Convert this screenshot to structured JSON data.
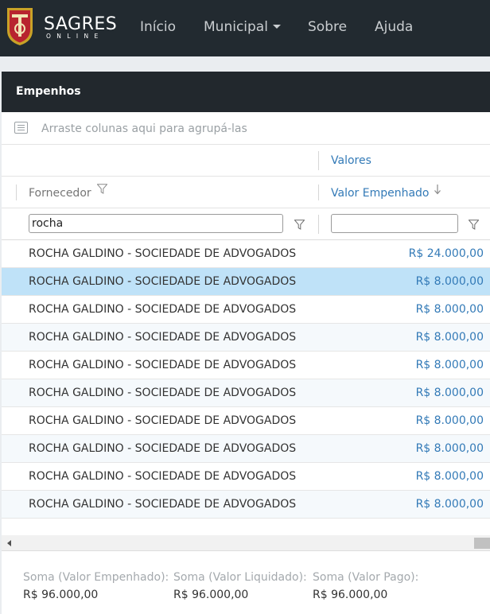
{
  "navbar": {
    "brand": "SAGRES",
    "brand_sub": "ONLINE",
    "items": [
      {
        "label": "Início"
      },
      {
        "label": "Municipal",
        "dropdown": true
      },
      {
        "label": "Sobre"
      },
      {
        "label": "Ajuda"
      }
    ],
    "colors": {
      "background": "#222a30",
      "text": "#c9cdd0"
    }
  },
  "panel": {
    "title": "Empenhos"
  },
  "grid": {
    "group_placeholder": "Arraste colunas aqui para agrupá-las",
    "band_header": "Valores",
    "columns": [
      {
        "label": "Fornecedor",
        "filter_value": ""
      },
      {
        "label": "Valor Empenhado",
        "sort": "descending"
      }
    ],
    "filters": {
      "fornecedor": "rocha",
      "valor_empenhado": ""
    },
    "rows": [
      {
        "fornecedor": "ROCHA GALDINO - SOCIEDADE DE ADVOGADOS",
        "valor": "R$ 24.000,00"
      },
      {
        "fornecedor": "ROCHA GALDINO - SOCIEDADE DE ADVOGADOS",
        "valor": "R$ 8.000,00",
        "selected": true
      },
      {
        "fornecedor": "ROCHA GALDINO - SOCIEDADE DE ADVOGADOS",
        "valor": "R$ 8.000,00"
      },
      {
        "fornecedor": "ROCHA GALDINO - SOCIEDADE DE ADVOGADOS",
        "valor": "R$ 8.000,00"
      },
      {
        "fornecedor": "ROCHA GALDINO - SOCIEDADE DE ADVOGADOS",
        "valor": "R$ 8.000,00"
      },
      {
        "fornecedor": "ROCHA GALDINO - SOCIEDADE DE ADVOGADOS",
        "valor": "R$ 8.000,00"
      },
      {
        "fornecedor": "ROCHA GALDINO - SOCIEDADE DE ADVOGADOS",
        "valor": "R$ 8.000,00"
      },
      {
        "fornecedor": "ROCHA GALDINO - SOCIEDADE DE ADVOGADOS",
        "valor": "R$ 8.000,00"
      },
      {
        "fornecedor": "ROCHA GALDINO - SOCIEDADE DE ADVOGADOS",
        "valor": "R$ 8.000,00"
      },
      {
        "fornecedor": "ROCHA GALDINO - SOCIEDADE DE ADVOGADOS",
        "valor": "R$ 8.000,00"
      }
    ],
    "colors": {
      "link_blue": "#337ab7",
      "selected_row": "#bfe2f8"
    }
  },
  "summary": [
    {
      "label": "Soma (Valor Empenhado):",
      "value": "R$ 96.000,00"
    },
    {
      "label": "Soma (Valor Liquidado):",
      "value": "R$ 96.000,00"
    },
    {
      "label": "Soma (Valor Pago):",
      "value": "R$ 96.000,00"
    }
  ]
}
